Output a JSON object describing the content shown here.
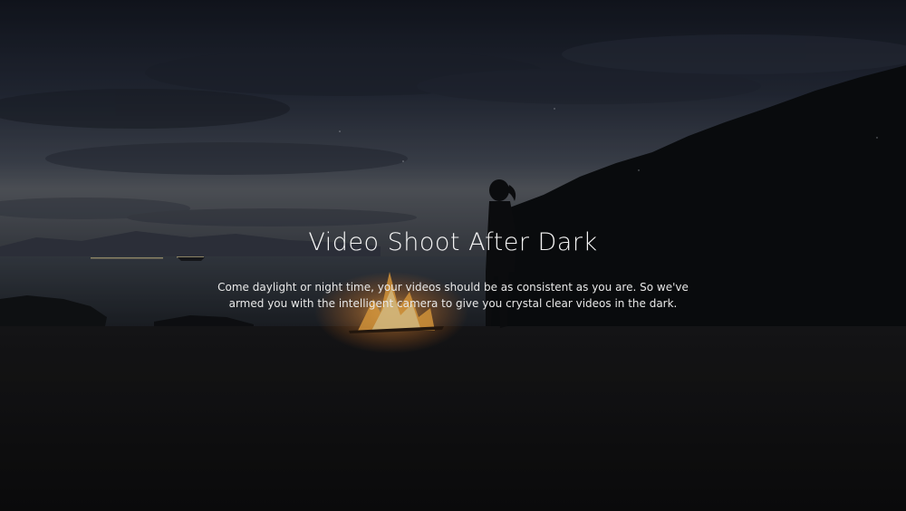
{
  "hero": {
    "title": "Video Shoot After Dark",
    "description_line1": "Come daylight or night time, your videos should be as consistent as you are. So we've",
    "description_line2": "armed you with the intelligent camera to give you crystal clear videos in the dark."
  },
  "colors": {
    "sky_top": "#1a1f2b",
    "sky_mid": "#2e3442",
    "horizon": "#5a5f6a",
    "sea": "#2a2f38",
    "sand": "#121214",
    "hill": "#0c0f12",
    "fire": "#ffb347",
    "text": "#ffffff"
  }
}
